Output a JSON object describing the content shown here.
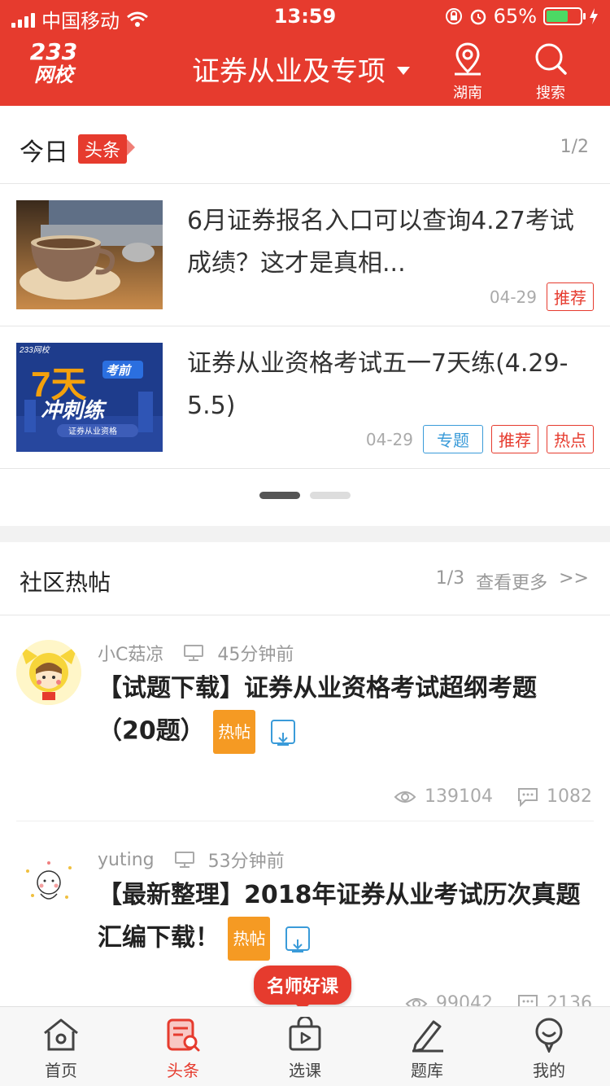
{
  "status_bar": {
    "carrier": "中国移动",
    "time": "13:59",
    "battery": "65%",
    "battery_level": 0.65
  },
  "header": {
    "logo_line1": "233",
    "logo_line2": "网校",
    "title": "证券从业及专项",
    "location_label": "湖南",
    "search_label": "搜索",
    "brand_color": "#e63b2e"
  },
  "today": {
    "title": "今日",
    "tag": "头条",
    "page_indicator": "1/2",
    "news": [
      {
        "title": "6月证券报名入口可以查询4.27考试成绩？这才是真相...",
        "date": "04-29",
        "tags": [
          "推荐"
        ]
      },
      {
        "title": "证券从业资格考试五一7天练(4.29-5.5)",
        "date": "04-29",
        "tags": [
          "专题",
          "推荐",
          "热点"
        ],
        "thumb_text": {
          "brand": "233网校",
          "big": "7天",
          "badge": "考前",
          "sub": "冲刺练",
          "foot": "证券从业资格"
        }
      }
    ]
  },
  "community": {
    "title": "社区热帖",
    "page_indicator": "1/3",
    "more_label": "查看更多",
    "more_arrow": ">>",
    "posts": [
      {
        "author": "小C菇凉",
        "time": "45分钟前",
        "title": "【试题下载】证券从业资格考试超纲考题（20题）",
        "badge": "热帖",
        "views": "139104",
        "comments": "1082"
      },
      {
        "author": "yuting",
        "time": "53分钟前",
        "title": "【最新整理】2018年证券从业考试历次真题汇编下载！",
        "badge": "热帖",
        "views": "99042",
        "comments": "2136"
      }
    ]
  },
  "promo": "名师好课",
  "tabbar": {
    "items": [
      {
        "label": "首页"
      },
      {
        "label": "头条"
      },
      {
        "label": "选课"
      },
      {
        "label": "题库"
      },
      {
        "label": "我的"
      }
    ],
    "active_color": "#e63b2e"
  }
}
